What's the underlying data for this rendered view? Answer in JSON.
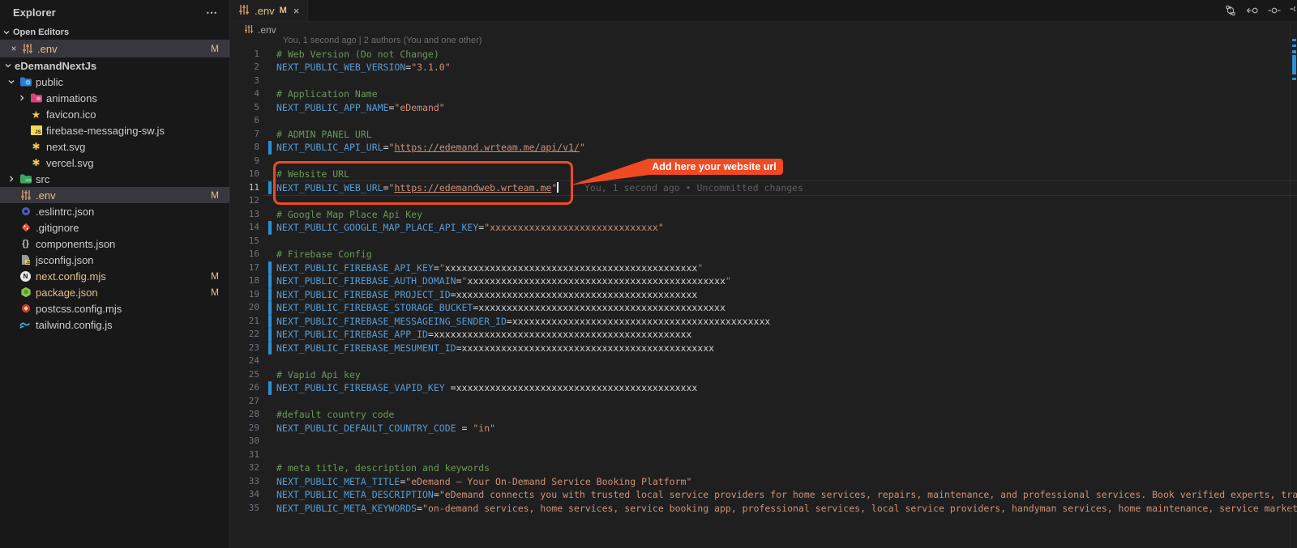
{
  "explorer": {
    "title": "Explorer",
    "overflow_icon": "⋯",
    "open_editors_label": "Open Editors",
    "open_editors": [
      {
        "label": ".env",
        "icon": "env",
        "badge": "M",
        "close": "×",
        "selected": true,
        "modified": true
      }
    ],
    "root_label": "eDemandNextJs",
    "tree": [
      {
        "label": "public",
        "icon": "folder-public",
        "chevron": "down",
        "indent": 1
      },
      {
        "label": "animations",
        "icon": "folder-animations",
        "chevron": "right",
        "indent": 2
      },
      {
        "label": "favicon.ico",
        "icon": "star",
        "indent": 2
      },
      {
        "label": "firebase-messaging-sw.js",
        "icon": "jsq",
        "indent": 2
      },
      {
        "label": "next.svg",
        "icon": "svgfile",
        "indent": 2
      },
      {
        "label": "vercel.svg",
        "icon": "svgfile",
        "indent": 2
      },
      {
        "label": "src",
        "icon": "folder-src",
        "chevron": "right",
        "indent": 1
      },
      {
        "label": ".env",
        "icon": "env",
        "indent": 1,
        "selected": true,
        "modified": true,
        "badge": "M"
      },
      {
        "label": ".eslintrc.json",
        "icon": "eslint",
        "indent": 1
      },
      {
        "label": ".gitignore",
        "icon": "git",
        "indent": 1
      },
      {
        "label": "components.json",
        "icon": "braces",
        "indent": 1
      },
      {
        "label": "jsconfig.json",
        "icon": "jsconfig",
        "indent": 1
      },
      {
        "label": "next.config.mjs",
        "icon": "nextjs",
        "indent": 1,
        "modified": true,
        "badge": "M"
      },
      {
        "label": "package.json",
        "icon": "node",
        "indent": 1,
        "modified": true,
        "badge": "M"
      },
      {
        "label": "postcss.config.mjs",
        "icon": "postcss",
        "indent": 1
      },
      {
        "label": "tailwind.config.js",
        "icon": "tailwind",
        "indent": 1
      }
    ]
  },
  "tabbar": {
    "tabs": [
      {
        "label": ".env",
        "icon": "env",
        "badge": "M",
        "close": "×",
        "active": true
      }
    ],
    "actions": [
      "git-compare-icon",
      "open-previous-change-icon",
      "circle-dash-icon",
      "circle-cut-icon"
    ]
  },
  "breadcrumb": {
    "icon": "env",
    "label": ".env"
  },
  "editor": {
    "codelens_blame": "You, 1 second ago | 2 authors (You and one other)",
    "inline_blame": "You, 1 second ago • Uncommitted changes",
    "annotation_label": "Add here your website url",
    "active_line": 11,
    "modified_lines": [
      8,
      11,
      14,
      17,
      18,
      19,
      20,
      21,
      22,
      23,
      26
    ],
    "lines": [
      {
        "n": 1,
        "segs": [
          [
            "c",
            "# Web Version (Do not Change)"
          ]
        ]
      },
      {
        "n": 2,
        "segs": [
          [
            "k",
            "NEXT_PUBLIC_WEB_VERSION"
          ],
          [
            "o",
            "="
          ],
          [
            "s",
            "\"3.1.0\""
          ]
        ]
      },
      {
        "n": 3,
        "segs": []
      },
      {
        "n": 4,
        "segs": [
          [
            "c",
            "# Application Name"
          ]
        ]
      },
      {
        "n": 5,
        "segs": [
          [
            "k",
            "NEXT_PUBLIC_APP_NAME"
          ],
          [
            "o",
            "="
          ],
          [
            "s",
            "\"eDemand\""
          ]
        ]
      },
      {
        "n": 6,
        "segs": []
      },
      {
        "n": 7,
        "segs": [
          [
            "c",
            "# ADMIN PANEL URL"
          ]
        ]
      },
      {
        "n": 8,
        "segs": [
          [
            "k",
            "NEXT_PUBLIC_API_URL"
          ],
          [
            "o",
            "="
          ],
          [
            "s",
            "\""
          ],
          [
            "u",
            "https://edemand.wrteam.me/api/v1/"
          ],
          [
            "s",
            "\""
          ]
        ]
      },
      {
        "n": 9,
        "segs": []
      },
      {
        "n": 10,
        "segs": [
          [
            "c",
            "# Website URL"
          ]
        ]
      },
      {
        "n": 11,
        "segs": [
          [
            "k",
            "NEXT_PUBLIC_WEB_URL"
          ],
          [
            "o",
            "="
          ],
          [
            "s",
            "\""
          ],
          [
            "u",
            "https://edemandweb.wrteam.me"
          ],
          [
            "s",
            "\""
          ]
        ]
      },
      {
        "n": 12,
        "segs": []
      },
      {
        "n": 13,
        "segs": [
          [
            "c",
            "# Google Map Place Api Key"
          ]
        ]
      },
      {
        "n": 14,
        "segs": [
          [
            "k",
            "NEXT_PUBLIC_GOOGLE_MAP_PLACE_API_KEY"
          ],
          [
            "o",
            "="
          ],
          [
            "s",
            "\"xxxxxxxxxxxxxxxxxxxxxxxxxxxxxx\""
          ]
        ]
      },
      {
        "n": 15,
        "segs": []
      },
      {
        "n": 16,
        "segs": [
          [
            "c",
            "# Firebase Config"
          ]
        ]
      },
      {
        "n": 17,
        "segs": [
          [
            "k",
            "NEXT_PUBLIC_FIREBASE_API_KEY"
          ],
          [
            "o",
            "="
          ],
          [
            "d",
            "\""
          ],
          [
            "p",
            "xxxxxxxxxxxxxxxxxxxxxxxxxxxxxxxxxxxxxxxxxxxxx"
          ],
          [
            "d",
            "\""
          ]
        ]
      },
      {
        "n": 18,
        "segs": [
          [
            "k",
            "NEXT_PUBLIC_FIREBASE_AUTH_DOMAIN"
          ],
          [
            "o",
            "="
          ],
          [
            "d",
            "\""
          ],
          [
            "p",
            "xxxxxxxxxxxxxxxxxxxxxxxxxxxxxxxxxxxxxxxxxxxxxx"
          ],
          [
            "d",
            "\""
          ]
        ]
      },
      {
        "n": 19,
        "segs": [
          [
            "k",
            "NEXT_PUBLIC_FIREBASE_PROJECT_ID"
          ],
          [
            "o",
            "="
          ],
          [
            "p",
            "xxxxxxxxxxxxxxxxxxxxxxxxxxxxxxxxxxxxxxxxxxx"
          ]
        ]
      },
      {
        "n": 20,
        "segs": [
          [
            "k",
            "NEXT_PUBLIC_FIREBASE_STORAGE_BUCKET"
          ],
          [
            "o",
            "="
          ],
          [
            "p",
            "xxxxxxxxxxxxxxxxxxxxxxxxxxxxxxxxxxxxxxxxxxxx"
          ]
        ]
      },
      {
        "n": 21,
        "segs": [
          [
            "k",
            "NEXT_PUBLIC_FIREBASE_MESSAGEING_SENDER_ID"
          ],
          [
            "o",
            "="
          ],
          [
            "p",
            "xxxxxxxxxxxxxxxxxxxxxxxxxxxxxxxxxxxxxxxxxxxxxx"
          ]
        ]
      },
      {
        "n": 22,
        "segs": [
          [
            "k",
            "NEXT_PUBLIC_FIREBASE_APP_ID"
          ],
          [
            "o",
            "="
          ],
          [
            "p",
            "xxxxxxxxxxxxxxxxxxxxxxxxxxxxxxxxxxxxxxxxxxxxxx"
          ]
        ]
      },
      {
        "n": 23,
        "segs": [
          [
            "k",
            "NEXT_PUBLIC_FIREBASE_MESUMENT_ID"
          ],
          [
            "o",
            "="
          ],
          [
            "p",
            "xxxxxxxxxxxxxxxxxxxxxxxxxxxxxxxxxxxxxxxxxxxxx"
          ]
        ]
      },
      {
        "n": 24,
        "segs": []
      },
      {
        "n": 25,
        "segs": [
          [
            "c",
            "# Vapid Api key"
          ]
        ]
      },
      {
        "n": 26,
        "segs": [
          [
            "k",
            "NEXT_PUBLIC_FIREBASE_VAPID_KEY"
          ],
          [
            "p",
            " "
          ],
          [
            "o",
            "="
          ],
          [
            "p",
            "xxxxxxxxxxxxxxxxxxxxxxxxxxxxxxxxxxxxxxxxxxx"
          ]
        ]
      },
      {
        "n": 27,
        "segs": []
      },
      {
        "n": 28,
        "segs": [
          [
            "c",
            "#default country code"
          ]
        ]
      },
      {
        "n": 29,
        "segs": [
          [
            "k",
            "NEXT_PUBLIC_DEFAULT_COUNTRY_CODE"
          ],
          [
            "p",
            " "
          ],
          [
            "o",
            "="
          ],
          [
            "p",
            " "
          ],
          [
            "s",
            "\"in\""
          ]
        ]
      },
      {
        "n": 30,
        "segs": []
      },
      {
        "n": 31,
        "segs": []
      },
      {
        "n": 32,
        "segs": [
          [
            "c",
            "# meta title, description and keywords"
          ]
        ]
      },
      {
        "n": 33,
        "segs": [
          [
            "k",
            "NEXT_PUBLIC_META_TITLE"
          ],
          [
            "o",
            "="
          ],
          [
            "s",
            "\"eDemand – Your On-Demand Service Booking Platform\""
          ]
        ]
      },
      {
        "n": 34,
        "segs": [
          [
            "k",
            "NEXT_PUBLIC_META_DESCRIPTION"
          ],
          [
            "o",
            "="
          ],
          [
            "s",
            "\"eDemand connects you with trusted local service providers for home services, repairs, maintenance, and professional services. Book verified experts, track appo"
          ]
        ]
      },
      {
        "n": 35,
        "segs": [
          [
            "k",
            "NEXT_PUBLIC_META_KEYWORDS"
          ],
          [
            "o",
            "="
          ],
          [
            "s",
            "\"on-demand services, home services, service booking app, professional services, local service providers, handyman services, home maintenance, service marketplace,"
          ]
        ]
      }
    ]
  },
  "colors": {
    "annotation_red": "#f04a23",
    "modified_tan": "#e2c08d",
    "gutter_modified_blue": "#2e8fd5",
    "comment_green": "#6a9955",
    "key_blue": "#569cd6",
    "string_orange": "#ce9178",
    "sidebar_bg": "#181818",
    "editor_bg": "#1f1f1f",
    "selection_row": "#37373d"
  }
}
